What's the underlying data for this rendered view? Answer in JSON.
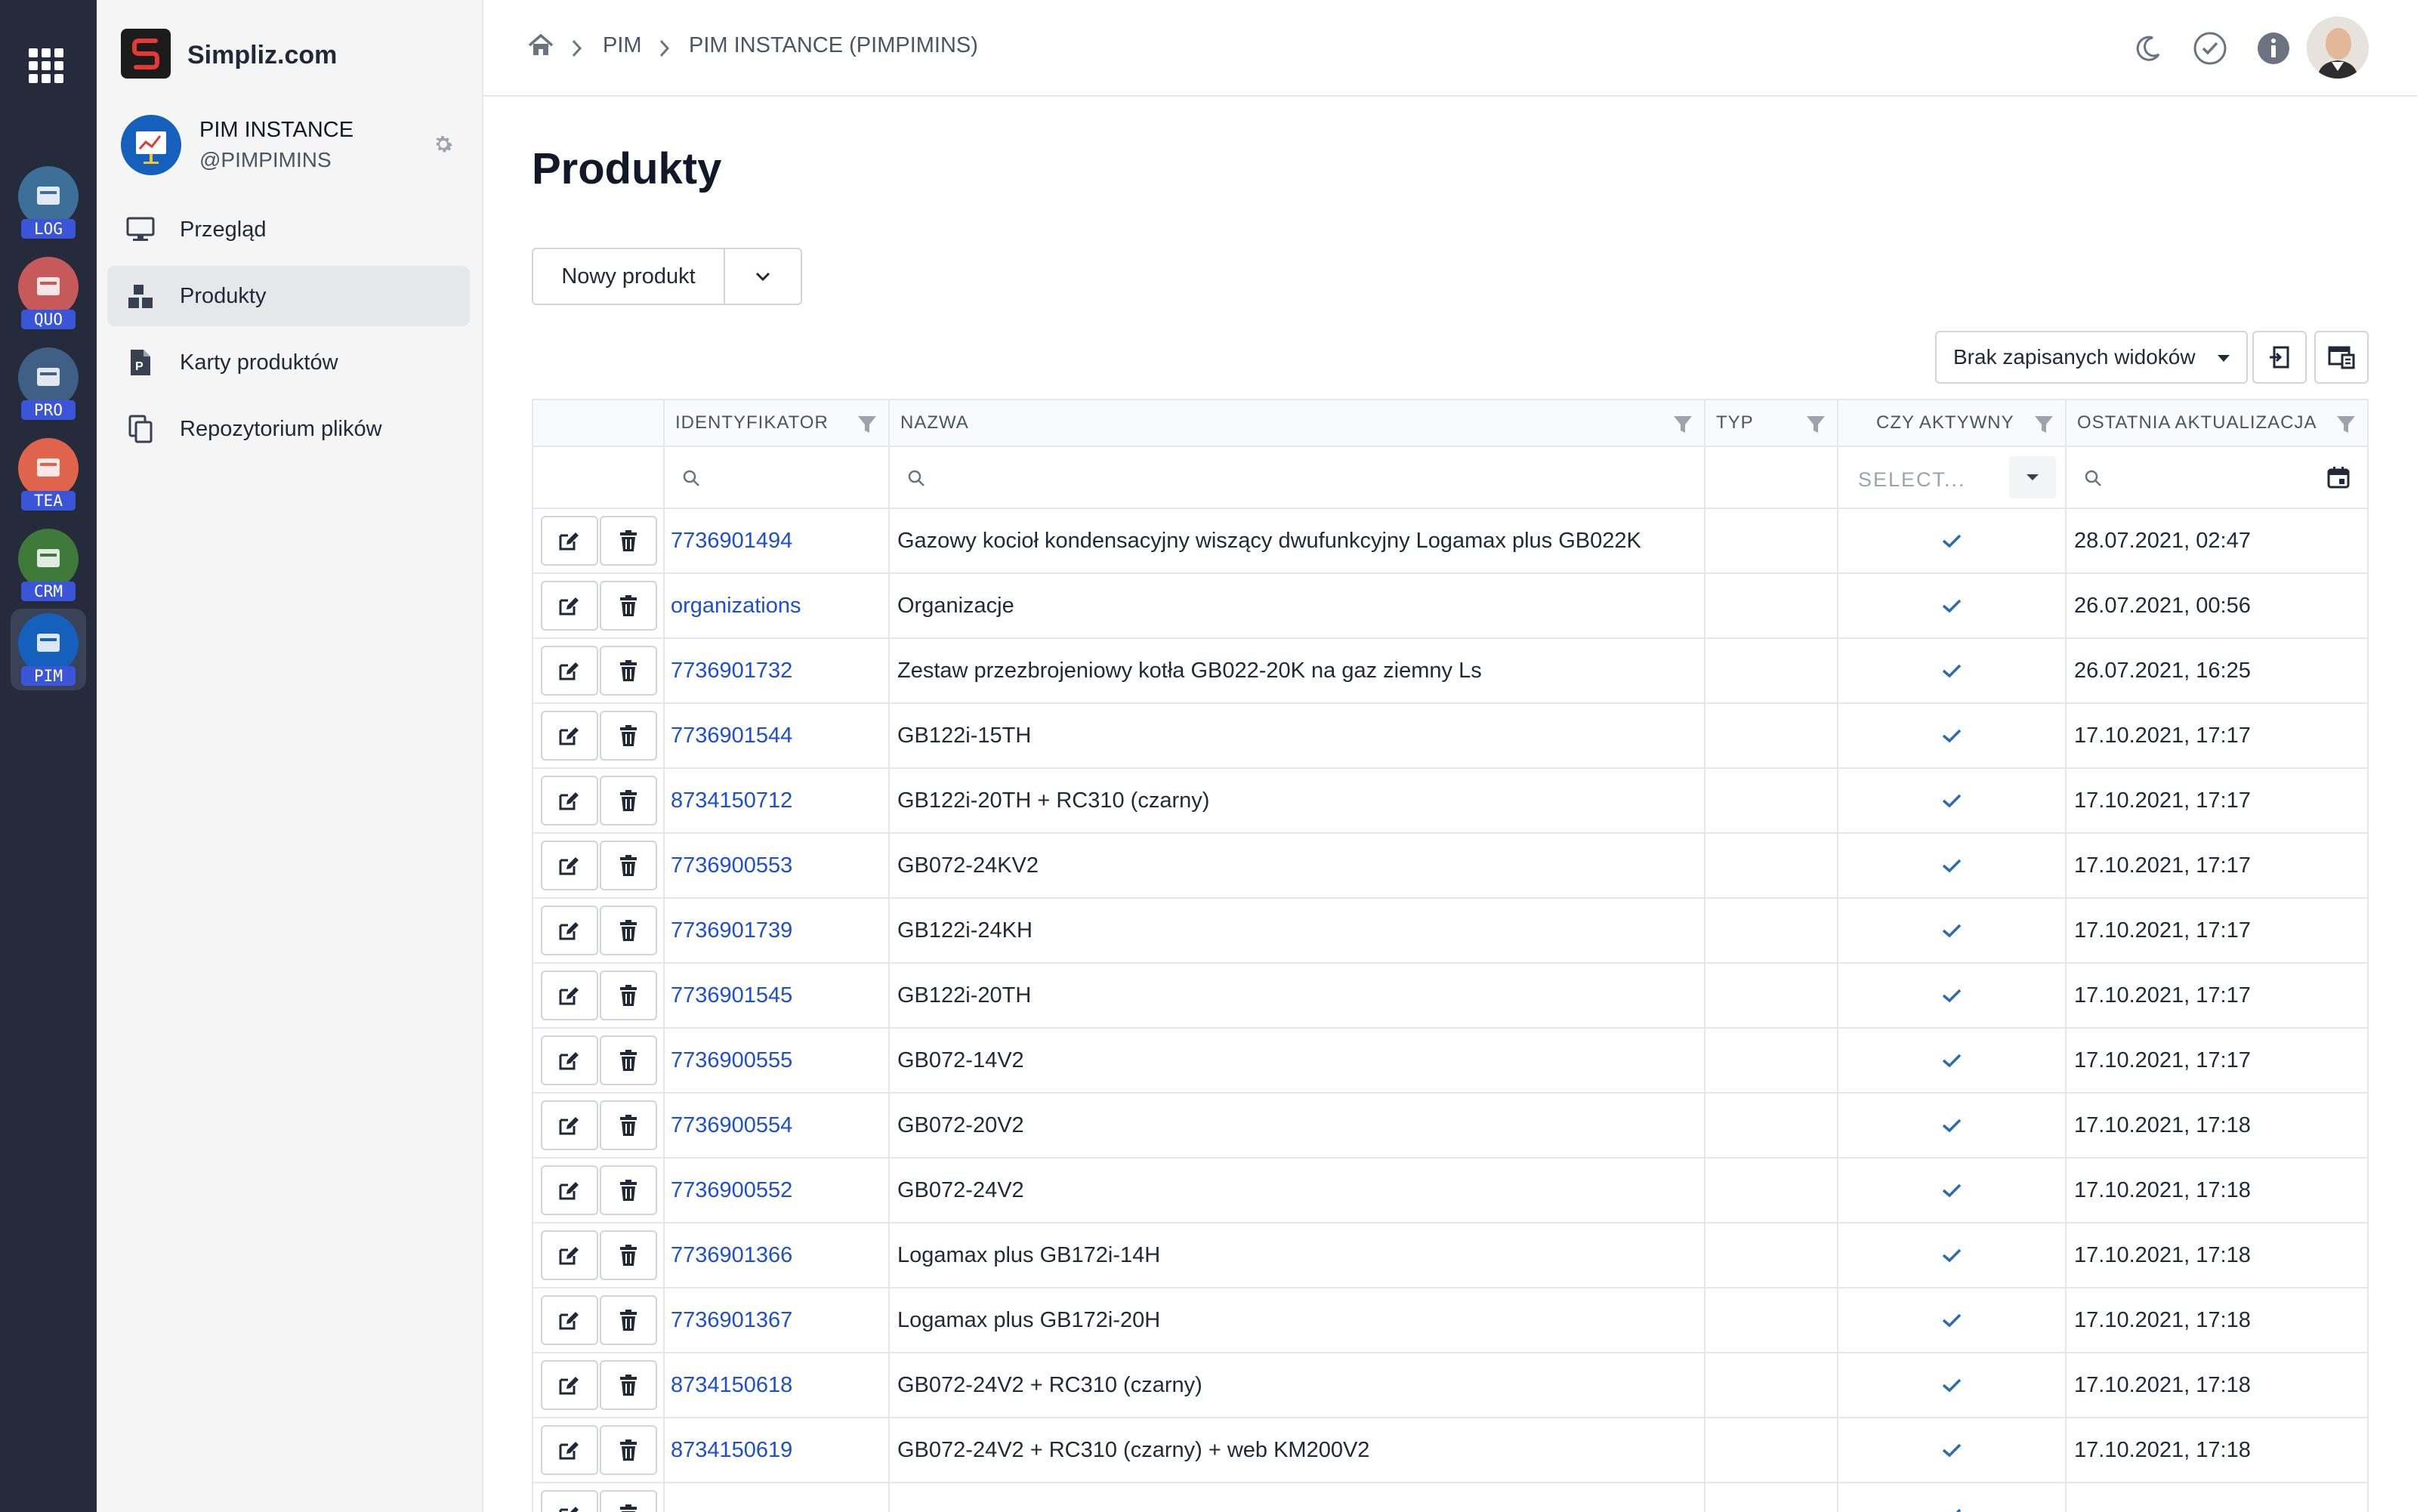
{
  "brand": {
    "name": "Simpliz.com",
    "logo_letter": "S"
  },
  "rail": {
    "apps": [
      {
        "code": "LOG",
        "color": "#3d6f9b"
      },
      {
        "code": "QUO",
        "color": "#c65a5a"
      },
      {
        "code": "PRO",
        "color": "#3f5f86"
      },
      {
        "code": "TEA",
        "color": "#e0644c"
      },
      {
        "code": "CRM",
        "color": "#3f7a3a"
      },
      {
        "code": "PIM",
        "color": "#1560bd"
      }
    ],
    "active": "PIM"
  },
  "instance": {
    "name": "PIM INSTANCE",
    "handle": "@PIMPIMINS"
  },
  "nav": {
    "items": [
      {
        "label": "Przegląd",
        "icon": "monitor-icon"
      },
      {
        "label": "Produkty",
        "icon": "boxes-icon"
      },
      {
        "label": "Karty produktów",
        "icon": "document-icon"
      },
      {
        "label": "Repozytorium plików",
        "icon": "files-icon"
      }
    ],
    "active": "Produkty"
  },
  "breadcrumb": {
    "items": [
      "PIM",
      "PIM INSTANCE (PIMPIMINS)"
    ]
  },
  "page": {
    "title": "Produkty"
  },
  "toolbar": {
    "new_label": "Nowy produkt",
    "views_label": "Brak zapisanych widoków"
  },
  "table": {
    "columns": [
      "",
      "IDENTYFIKATOR",
      "NAZWA",
      "TYP",
      "CZY AKTYWNY",
      "OSTATNIA AKTUALIZACJA"
    ],
    "select_placeholder": "SELECT...",
    "rows": [
      {
        "id": "7736901494",
        "name": "Gazowy kocioł kondensacyjny wiszący dwufunkcyjny Logamax plus GB022K",
        "type": "",
        "active": true,
        "updated": "28.07.2021, 02:47"
      },
      {
        "id": "organizations",
        "name": "Organizacje",
        "type": "",
        "active": true,
        "updated": "26.07.2021, 00:56"
      },
      {
        "id": "7736901732",
        "name": "Zestaw przezbrojeniowy kotła GB022-20K na gaz ziemny Ls",
        "type": "",
        "active": true,
        "updated": "26.07.2021, 16:25"
      },
      {
        "id": "7736901544",
        "name": "GB122i-15TH",
        "type": "",
        "active": true,
        "updated": "17.10.2021, 17:17"
      },
      {
        "id": "8734150712",
        "name": "GB122i-20TH + RC310 (czarny)",
        "type": "",
        "active": true,
        "updated": "17.10.2021, 17:17"
      },
      {
        "id": "7736900553",
        "name": "GB072-24KV2",
        "type": "",
        "active": true,
        "updated": "17.10.2021, 17:17"
      },
      {
        "id": "7736901739",
        "name": "GB122i-24KH",
        "type": "",
        "active": true,
        "updated": "17.10.2021, 17:17"
      },
      {
        "id": "7736901545",
        "name": "GB122i-20TH",
        "type": "",
        "active": true,
        "updated": "17.10.2021, 17:17"
      },
      {
        "id": "7736900555",
        "name": "GB072-14V2",
        "type": "",
        "active": true,
        "updated": "17.10.2021, 17:17"
      },
      {
        "id": "7736900554",
        "name": "GB072-20V2",
        "type": "",
        "active": true,
        "updated": "17.10.2021, 17:18"
      },
      {
        "id": "7736900552",
        "name": "GB072-24V2",
        "type": "",
        "active": true,
        "updated": "17.10.2021, 17:18"
      },
      {
        "id": "7736901366",
        "name": "Logamax plus GB172i-14H",
        "type": "",
        "active": true,
        "updated": "17.10.2021, 17:18"
      },
      {
        "id": "7736901367",
        "name": "Logamax plus GB172i-20H",
        "type": "",
        "active": true,
        "updated": "17.10.2021, 17:18"
      },
      {
        "id": "8734150618",
        "name": "GB072-24V2 + RC310 (czarny)",
        "type": "",
        "active": true,
        "updated": "17.10.2021, 17:18"
      },
      {
        "id": "8734150619",
        "name": "GB072-24V2 + RC310 (czarny) + web KM200V2",
        "type": "",
        "active": true,
        "updated": "17.10.2021, 17:18"
      }
    ]
  },
  "colors": {
    "link": "#1d4ed8",
    "rail_bg": "#252b3b",
    "nav_bg": "#f5f5f5",
    "check": "#2b6cb0"
  }
}
